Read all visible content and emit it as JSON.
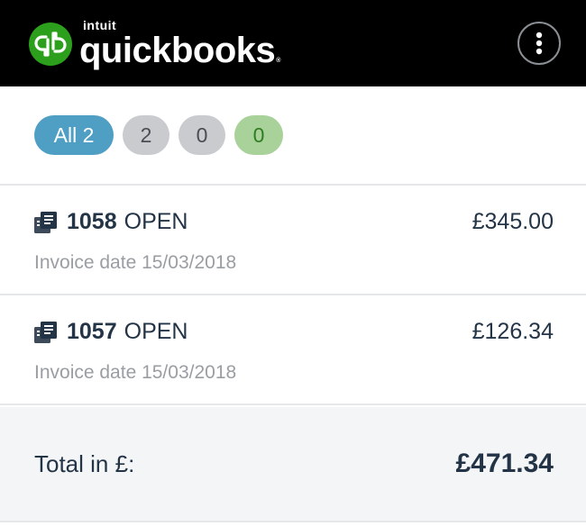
{
  "header": {
    "brand_top": "intuit",
    "brand_name": "quickbooks",
    "brand_mark": "qb",
    "menu_icon": "vertical-ellipsis-icon"
  },
  "filters": {
    "all_label": "All 2",
    "pill_2": "2",
    "pill_3": "0",
    "pill_4": "0"
  },
  "invoices": [
    {
      "number": "1058",
      "status": "OPEN",
      "amount": "£345.00",
      "date_line": "Invoice date 15/03/2018",
      "icon": "invoice-document-icon"
    },
    {
      "number": "1057",
      "status": "OPEN",
      "amount": "£126.34",
      "date_line": "Invoice date 15/03/2018",
      "icon": "invoice-document-icon"
    }
  ],
  "total": {
    "label": "Total in £:",
    "amount": "£471.34"
  },
  "colors": {
    "header_bg": "#000000",
    "brand_green": "#2ca01c",
    "pill_all": "#4f9ec4",
    "pill_grey": "#c9cbcf",
    "pill_green": "#a9d19a",
    "text_dark": "#243447",
    "text_muted": "#9a9ea3"
  }
}
